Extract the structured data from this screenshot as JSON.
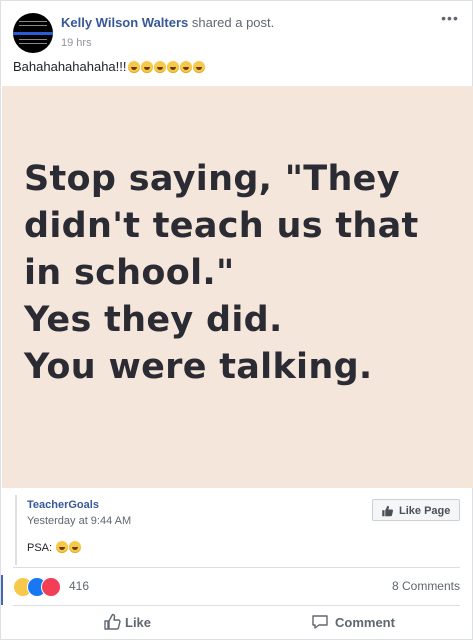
{
  "post": {
    "author": "Kelly Wilson Walters",
    "action": " shared a post.",
    "time": "19 hrs",
    "text": "Bahahahahahaha!!!",
    "text_emoji_count": 6,
    "more_icon": "more-horizontal-icon"
  },
  "image": {
    "lines": [
      "Stop saying, \"They",
      "didn't teach us that",
      "in school.\"",
      "Yes they did.",
      "You were talking."
    ],
    "background": "#f5e6dc",
    "text_color": "#2b2b33"
  },
  "source": {
    "name": "TeacherGoals",
    "time": "Yesterday at 9:44 AM",
    "text": "PSA: ",
    "like_page_label": "Like Page"
  },
  "reactions": {
    "count": "416",
    "comments": "8 Comments",
    "types": [
      "haha",
      "like",
      "love"
    ]
  },
  "actions": {
    "like_label": "Like",
    "comment_label": "Comment"
  },
  "colors": {
    "link": "#385898",
    "like_blue": "#1877f2",
    "love_red": "#f33e58",
    "haha_yellow": "#f7c94a"
  }
}
